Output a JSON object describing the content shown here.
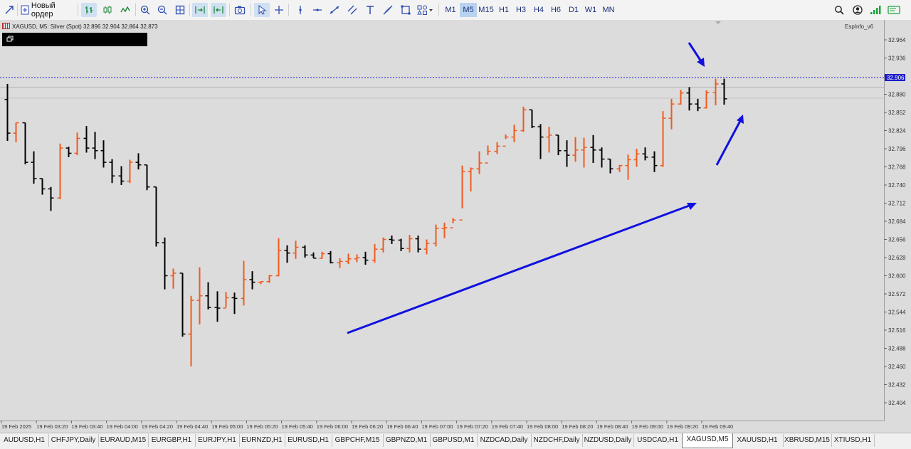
{
  "toolbar": {
    "new_order_label": "Новый ордер",
    "timeframes": [
      "M1",
      "M5",
      "M15",
      "H1",
      "H3",
      "H4",
      "H6",
      "D1",
      "W1",
      "MN"
    ],
    "active_timeframe": "M5"
  },
  "chart": {
    "symbol_label": "XAGUSD, M5:  Silver (Spot)  32.896 32.904 32.864 32.873",
    "indicator_label": "EspInfo_v6",
    "current_price": "32.906",
    "price_levels": [
      "32.964",
      "32.936",
      "32.908",
      "32.880",
      "32.852",
      "32.824",
      "32.796",
      "32.768",
      "32.740",
      "32.712",
      "32.684",
      "32.656",
      "32.628",
      "32.600",
      "32.572",
      "32.544",
      "32.516",
      "32.488",
      "32.460",
      "32.432",
      "32.404"
    ],
    "time_labels": [
      "19 Feb 2025",
      "19 Feb 03:20",
      "19 Feb 03:40",
      "19 Feb 04:00",
      "19 Feb 04:20",
      "19 Feb 04:40",
      "19 Feb 05:00",
      "19 Feb 05:20",
      "19 Feb 05:40",
      "19 Feb 06:00",
      "19 Feb 06:20",
      "19 Feb 06:40",
      "19 Feb 07:00",
      "19 Feb 07:20",
      "19 Feb 07:40",
      "19 Feb 08:00",
      "19 Feb 08:20",
      "19 Feb 08:40",
      "19 Feb 09:00",
      "19 Feb 09:20",
      "19 Feb 09:40"
    ],
    "colors": {
      "bull": "#f05a1e",
      "bear": "#000000",
      "background": "#dcdcdc",
      "annotation": "#1010e0",
      "price_line": "#2020e0"
    }
  },
  "chart_data": {
    "type": "ohlc",
    "symbol": "XAGUSD",
    "timeframe": "M5",
    "ylim": [
      32.404,
      32.964
    ],
    "bars": [
      [
        32.872,
        32.896,
        32.808,
        32.82
      ],
      [
        32.82,
        32.836,
        32.806,
        32.836
      ],
      [
        32.836,
        32.836,
        32.772,
        32.775
      ],
      [
        32.775,
        32.792,
        32.742,
        32.75
      ],
      [
        32.75,
        32.75,
        32.725,
        32.734
      ],
      [
        32.734,
        32.737,
        32.7,
        32.72
      ],
      [
        32.72,
        32.804,
        32.718,
        32.797
      ],
      [
        32.797,
        32.799,
        32.783,
        32.789
      ],
      [
        32.789,
        32.821,
        32.786,
        32.812
      ],
      [
        32.812,
        32.831,
        32.79,
        32.797
      ],
      [
        32.797,
        32.822,
        32.78,
        32.793
      ],
      [
        32.793,
        32.809,
        32.767,
        32.775
      ],
      [
        32.775,
        32.78,
        32.743,
        32.754
      ],
      [
        32.754,
        32.769,
        32.74,
        32.746
      ],
      [
        32.746,
        32.779,
        32.743,
        32.775
      ],
      [
        32.775,
        32.789,
        32.764,
        32.771
      ],
      [
        32.771,
        32.771,
        32.732,
        32.737
      ],
      [
        32.737,
        32.737,
        32.645,
        32.651
      ],
      [
        32.651,
        32.659,
        32.579,
        32.6
      ],
      [
        32.6,
        32.611,
        32.58,
        32.604
      ],
      [
        32.604,
        32.604,
        32.506,
        32.51
      ],
      [
        32.51,
        32.569,
        32.46,
        32.562
      ],
      [
        32.562,
        32.613,
        32.525,
        32.569
      ],
      [
        32.569,
        32.59,
        32.548,
        32.551
      ],
      [
        32.551,
        32.576,
        32.529,
        32.55
      ],
      [
        32.55,
        32.575,
        32.551,
        32.566
      ],
      [
        32.566,
        32.574,
        32.541,
        32.565
      ],
      [
        32.565,
        32.623,
        32.554,
        32.594
      ],
      [
        32.594,
        32.607,
        32.579,
        32.59
      ],
      [
        32.59,
        32.591,
        32.587,
        32.591
      ],
      [
        32.591,
        32.601,
        32.589,
        32.6
      ],
      [
        32.6,
        32.658,
        32.599,
        32.639
      ],
      [
        32.639,
        32.647,
        32.62,
        32.635
      ],
      [
        32.635,
        32.654,
        32.626,
        32.644
      ],
      [
        32.644,
        32.647,
        32.628,
        32.632
      ],
      [
        32.632,
        32.636,
        32.627,
        32.627
      ],
      [
        32.627,
        32.637,
        32.626,
        32.634
      ],
      [
        32.634,
        32.638,
        32.619,
        32.62
      ],
      [
        32.62,
        32.627,
        32.612,
        32.622
      ],
      [
        32.622,
        32.634,
        32.618,
        32.626
      ],
      [
        32.626,
        32.633,
        32.621,
        32.628
      ],
      [
        32.628,
        32.637,
        32.617,
        32.624
      ],
      [
        32.624,
        32.649,
        32.62,
        32.641
      ],
      [
        32.641,
        32.659,
        32.636,
        32.656
      ],
      [
        32.656,
        32.662,
        32.649,
        32.655
      ],
      [
        32.655,
        32.657,
        32.638,
        32.642
      ],
      [
        32.642,
        32.663,
        32.636,
        32.657
      ],
      [
        32.657,
        32.662,
        32.636,
        32.641
      ],
      [
        32.641,
        32.656,
        32.633,
        32.65
      ],
      [
        32.65,
        32.679,
        32.645,
        32.673
      ],
      [
        32.673,
        32.682,
        32.658,
        32.674
      ],
      [
        32.674,
        32.689,
        32.681,
        32.686
      ],
      [
        32.686,
        32.77,
        32.704,
        32.761
      ],
      [
        32.761,
        32.767,
        32.73,
        32.765
      ],
      [
        32.765,
        32.792,
        32.757,
        32.774
      ],
      [
        32.774,
        32.801,
        32.786,
        32.792
      ],
      [
        32.792,
        32.806,
        32.788,
        32.8
      ],
      [
        32.8,
        32.818,
        32.811,
        32.814
      ],
      [
        32.814,
        32.833,
        32.806,
        32.824
      ],
      [
        32.824,
        32.861,
        32.822,
        32.856
      ],
      [
        32.856,
        32.856,
        32.828,
        32.83
      ],
      [
        32.83,
        32.834,
        32.78,
        32.814
      ],
      [
        32.814,
        32.83,
        32.79,
        32.817
      ],
      [
        32.817,
        32.817,
        32.786,
        32.793
      ],
      [
        32.793,
        32.809,
        32.768,
        32.786
      ],
      [
        32.786,
        32.814,
        32.776,
        32.794
      ],
      [
        32.794,
        32.813,
        32.767,
        32.798
      ],
      [
        32.798,
        32.817,
        32.774,
        32.794
      ],
      [
        32.794,
        32.798,
        32.767,
        32.78
      ],
      [
        32.78,
        32.78,
        32.758,
        32.765
      ],
      [
        32.765,
        32.771,
        32.76,
        32.77
      ],
      [
        32.77,
        32.787,
        32.748,
        32.779
      ],
      [
        32.779,
        32.796,
        32.768,
        32.788
      ],
      [
        32.788,
        32.798,
        32.778,
        32.783
      ],
      [
        32.783,
        32.792,
        32.76,
        32.77
      ],
      [
        32.77,
        32.854,
        32.768,
        32.843
      ],
      [
        32.843,
        32.873,
        32.826,
        32.865
      ],
      [
        32.865,
        32.887,
        32.864,
        32.882
      ],
      [
        32.882,
        32.891,
        32.855,
        32.865
      ],
      [
        32.865,
        32.873,
        32.854,
        32.859
      ],
      [
        32.859,
        32.886,
        32.858,
        32.883
      ],
      [
        32.883,
        32.904,
        32.863,
        32.896
      ],
      [
        32.896,
        32.904,
        32.864,
        32.873
      ]
    ]
  },
  "tabs": [
    "AUDUSD,H1",
    "CHFJPY,Daily",
    "EURAUD,M15",
    "EURGBP,H1",
    "EURJPY,H1",
    "EURNZD,H1",
    "EURUSD,H1",
    "GBPCHF,M15",
    "GBPNZD,M1",
    "GBPUSD,M1",
    "NZDCAD,Daily",
    "NZDCHF,Daily",
    "NZDUSD,Daily",
    "USDCAD,H1",
    "XAGUSD,M5",
    "XAUUSD,H1",
    "XBRUSD,M15",
    "XTIUSD,H1"
  ],
  "active_tab": "XAGUSD,M5"
}
